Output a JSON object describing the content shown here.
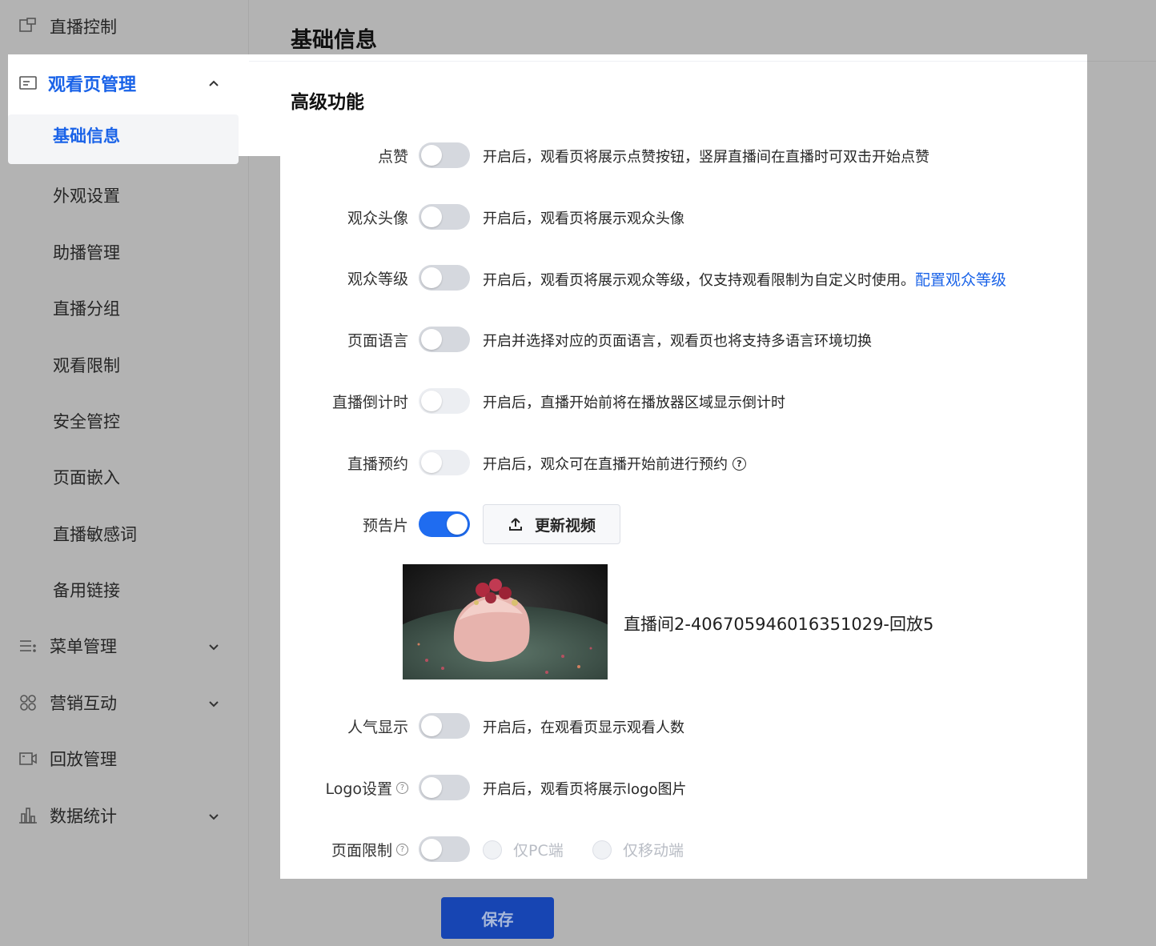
{
  "sidebar": {
    "top_item": "直播控制",
    "group": {
      "label": "观看页管理",
      "active_sub": "基础信息",
      "subs": [
        "外观设置",
        "助播管理",
        "直播分组",
        "观看限制",
        "安全管控",
        "页面嵌入",
        "直播敏感词",
        "备用链接"
      ]
    },
    "bottom_items": [
      "菜单管理",
      "营销互动",
      "回放管理",
      "数据统计"
    ]
  },
  "page": {
    "title": "基础信息",
    "section_title": "高级功能"
  },
  "settings": [
    {
      "label": "点赞",
      "enabled": false,
      "desc": "开启后，观看页将展示点赞按钮，竖屏直播间在直播时可双击开始点赞"
    },
    {
      "label": "观众头像",
      "enabled": false,
      "desc": "开启后，观看页将展示观众头像"
    },
    {
      "label": "观众等级",
      "enabled": false,
      "desc": "开启后，观看页将展示观众等级，仅支持观看限制为自定义时使用。",
      "link": "配置观众等级"
    },
    {
      "label": "页面语言",
      "enabled": false,
      "desc": "开启并选择对应的页面语言，观看页也将支持多语言环境切换"
    },
    {
      "label": "直播倒计时",
      "enabled": false,
      "desc": "开启后，直播开始前将在播放器区域显示倒计时"
    },
    {
      "label": "直播预约",
      "enabled": false,
      "desc": "开启后，观众可在直播开始前进行预约"
    },
    {
      "label": "预告片",
      "enabled": true,
      "button": "更新视频",
      "video_name": "直播间2-406705946016351029-回放5"
    },
    {
      "label": "人气显示",
      "enabled": false,
      "desc": "开启后，在观看页显示观看人数"
    },
    {
      "label": "Logo设置",
      "enabled": false,
      "desc": "开启后，观看页将展示logo图片"
    },
    {
      "label": "页面限制",
      "enabled": false,
      "options": [
        "仅PC端",
        "仅移动端"
      ]
    }
  ],
  "footer": {
    "save_label": "保存"
  },
  "colors": {
    "accent": "#1a63e8",
    "toggle_on": "#1f6cf0",
    "save_button": "#1745b3",
    "overlay": "#b3b3b3"
  }
}
